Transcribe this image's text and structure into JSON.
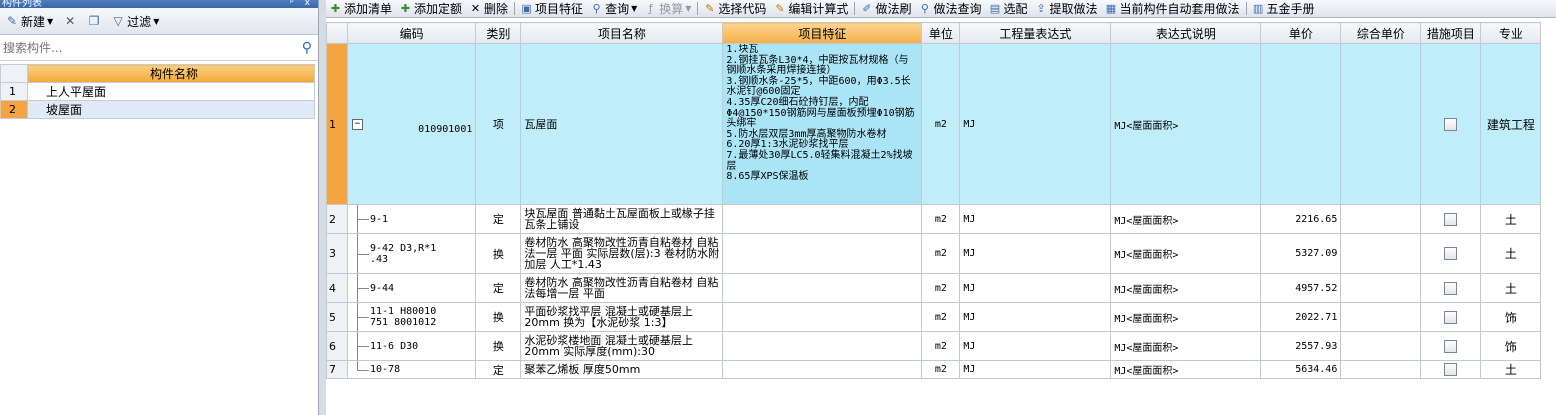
{
  "left_panel": {
    "title": "构件列表",
    "pin_icons": "ᵖ x",
    "toolbar": {
      "new_label": "新建",
      "filter_label": "过滤"
    },
    "search": {
      "placeholder": "搜索构件..."
    },
    "table": {
      "header": "构件名称",
      "rows": [
        {
          "num": "1",
          "name": "上人平屋面"
        },
        {
          "num": "2",
          "name": "坡屋面"
        }
      ]
    }
  },
  "toolbar": {
    "add_list": "添加清单",
    "add_quota": "添加定额",
    "delete": "删除",
    "item_feature": "项目特征",
    "query": "查询",
    "convert": "换算",
    "select_code": "选择代码",
    "edit_formula": "编辑计算式",
    "method_brush": "做法刷",
    "method_query": "做法查询",
    "select_match": "选配",
    "extract_method": "提取做法",
    "auto_apply": "当前构件自动套用做法",
    "hardware_manual": "五金手册"
  },
  "grid": {
    "headers": [
      "编码",
      "类别",
      "项目名称",
      "项目特征",
      "单位",
      "工程量表达式",
      "表达式说明",
      "单价",
      "综合单价",
      "措施项目",
      "专业"
    ],
    "rows": [
      {
        "num": "1",
        "code": "010901001",
        "type": "项",
        "name": "瓦屋面",
        "feature": "1.块瓦\n2.钢挂瓦条L30*4，中距按瓦材规格（与钢顺水条采用焊接连接）\n3.钢顺水条-25*5，中距600，用Φ3.5长水泥钉@600固定\n4.35厚C20细石砼持钉层，内配Φ4@150*150钢筋网与屋面板预埋Φ10钢筋头绑牢\n5.防水层双层3mm厚高聚物防水卷材\n6.20厚1:3水泥砂浆找平层\n7.最薄处30厚LC5.0轻集料混凝土2%找坡层\n8.65厚XPS保温板",
        "unit": "m2",
        "expr": "MJ",
        "expr_desc": "MJ<屋面面积>",
        "price": "",
        "composite_price": "",
        "measure": false,
        "specialty": "建筑工程"
      },
      {
        "num": "2",
        "code": "9-1",
        "type": "定",
        "name": "块瓦屋面 普通黏土瓦屋面板上或椽子挂瓦条上铺设",
        "feature": "",
        "unit": "m2",
        "expr": "MJ",
        "expr_desc": "MJ<屋面面积>",
        "price": "2216.65",
        "composite_price": "",
        "measure": false,
        "specialty": "土"
      },
      {
        "num": "3",
        "code": "9-42 D3,R*1\n.43",
        "type": "换",
        "name": "卷材防水 高聚物改性沥青自粘卷材 自粘法一层 平面 实际层数(层):3 卷材防水附加层 人工*1.43",
        "feature": "",
        "unit": "m2",
        "expr": "MJ",
        "expr_desc": "MJ<屋面面积>",
        "price": "5327.09",
        "composite_price": "",
        "measure": false,
        "specialty": "土"
      },
      {
        "num": "4",
        "code": "9-44",
        "type": "定",
        "name": "卷材防水 高聚物改性沥青自粘卷材 自粘法每增一层 平面",
        "feature": "",
        "unit": "m2",
        "expr": "MJ",
        "expr_desc": "MJ<屋面面积>",
        "price": "4957.52",
        "composite_price": "",
        "measure": false,
        "specialty": "土"
      },
      {
        "num": "5",
        "code": "11-1 H80010\n751 8001012",
        "type": "换",
        "name": "平面砂浆找平层 混凝土或硬基层上 20mm 换为【水泥砂浆 1:3】",
        "feature": "",
        "unit": "m2",
        "expr": "MJ",
        "expr_desc": "MJ<屋面面积>",
        "price": "2022.71",
        "composite_price": "",
        "measure": false,
        "specialty": "饰"
      },
      {
        "num": "6",
        "code": "11-6 D30",
        "type": "换",
        "name": "水泥砂浆楼地面 混凝土或硬基层上 20mm 实际厚度(mm):30",
        "feature": "",
        "unit": "m2",
        "expr": "MJ",
        "expr_desc": "MJ<屋面面积>",
        "price": "2557.93",
        "composite_price": "",
        "measure": false,
        "specialty": "饰"
      },
      {
        "num": "7",
        "code": "10-78",
        "type": "定",
        "name": "聚苯乙烯板 厚度50mm",
        "feature": "",
        "unit": "m2",
        "expr": "MJ",
        "expr_desc": "MJ<屋面面积>",
        "price": "5634.46",
        "composite_price": "",
        "measure": false,
        "specialty": "土"
      }
    ]
  }
}
